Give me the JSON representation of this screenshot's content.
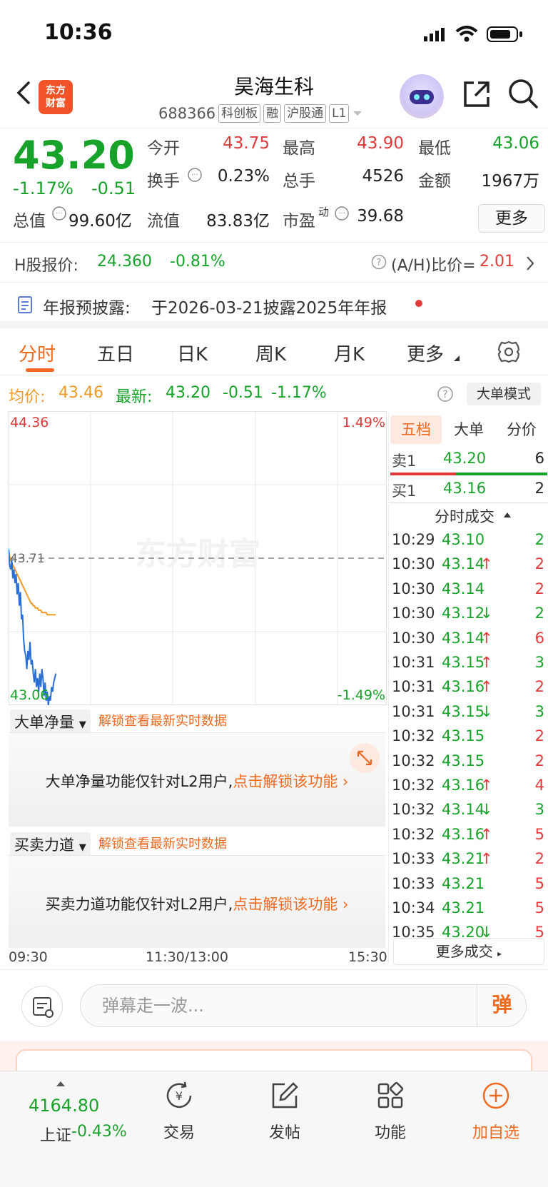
{
  "status_bar": {
    "time": "10:36"
  },
  "header": {
    "title": "昊海生科",
    "code": "688366",
    "tags": [
      "科创板",
      "融",
      "沪股通",
      "L1"
    ],
    "logo_text_line1": "东方",
    "logo_text_line2": "财富"
  },
  "quote": {
    "price": "43.20",
    "change_pct": "-1.17%",
    "change_abs": "-0.51",
    "open_label": "今开",
    "open": "43.75",
    "high_label": "最高",
    "high": "43.90",
    "low_label": "最低",
    "low": "43.06",
    "turnover_label": "换手",
    "turnover": "0.23%",
    "volume_label": "总手",
    "volume": "4526",
    "amount_label": "金额",
    "amount": "1967万",
    "mktcap_label": "总值",
    "mktcap": "99.60亿",
    "float_label": "流值",
    "float_cap": "83.83亿",
    "pe_label": "市盈",
    "pe_sup": "动",
    "pe": "39.68",
    "more_button": "更多"
  },
  "hshare": {
    "label": "H股报价:",
    "price": "24.360",
    "pct": "-0.81%",
    "ah_label": "(A/H)比价=",
    "ah_value": "2.01"
  },
  "annual": {
    "label": "年报预披露:",
    "text": "于2026-03-21披露2025年年报"
  },
  "tabs": [
    "分时",
    "五日",
    "日K",
    "周K",
    "月K",
    "更多"
  ],
  "avg_row": {
    "avg_label": "均价:",
    "avg": "43.46",
    "latest_label": "最新:",
    "latest": "43.20",
    "chg": "-0.51",
    "pct": "-1.17%",
    "mode_button": "大单模式"
  },
  "chart_data": {
    "type": "line",
    "title": "",
    "y_top": "44.36",
    "y_mid": "43.71",
    "y_bottom": "43.06",
    "pct_top": "1.49%",
    "pct_bottom": "-1.49%",
    "ylim": [
      43.06,
      44.36
    ],
    "prev_close": 43.71,
    "x_labels": [
      "09:30",
      "11:30/13:00",
      "15:30"
    ],
    "watermark": "东方财富",
    "series": [
      {
        "name": "价格",
        "color": "#2a6fd6",
        "values": [
          43.75,
          43.68,
          43.66,
          43.7,
          43.62,
          43.66,
          43.6,
          43.64,
          43.55,
          43.6,
          43.5,
          43.56,
          43.44,
          43.46,
          43.35,
          43.3,
          43.28,
          43.22,
          43.3,
          43.26,
          43.34,
          43.24,
          43.26,
          43.2,
          43.16,
          43.22,
          43.14,
          43.18,
          43.12,
          43.2,
          43.14,
          43.22,
          43.18,
          43.1,
          43.16,
          43.08,
          43.12,
          43.06,
          43.1,
          43.08,
          43.14,
          43.12,
          43.16,
          43.18,
          43.2
        ]
      },
      {
        "name": "均价",
        "color": "#f09a2a",
        "values": [
          43.75,
          43.72,
          43.7,
          43.69,
          43.68,
          43.67,
          43.66,
          43.65,
          43.64,
          43.63,
          43.62,
          43.61,
          43.6,
          43.59,
          43.58,
          43.57,
          43.56,
          43.55,
          43.54,
          43.53,
          43.52,
          43.51,
          43.51,
          43.5,
          43.5,
          43.49,
          43.49,
          43.49,
          43.48,
          43.48,
          43.48,
          43.47,
          43.47,
          43.47,
          43.47,
          43.47,
          43.46,
          43.46,
          43.46,
          43.46,
          43.46,
          43.46,
          43.46,
          43.46,
          43.46
        ]
      }
    ]
  },
  "l2": {
    "panel1_title": "大单净量",
    "panel2_title": "买卖力道",
    "unlock_link": "解锁查看最新实时数据",
    "msg1": "大单净量功能仅针对L2用户,",
    "msg2": "买卖力道功能仅针对L2用户,",
    "msg_link": "点击解锁该功能"
  },
  "right_panel": {
    "tabs": [
      "五档",
      "大单",
      "分价"
    ],
    "sell1": {
      "label": "卖1",
      "price": "43.20",
      "vol": "6"
    },
    "buy1": {
      "label": "买1",
      "price": "43.16",
      "vol": "2"
    },
    "ticks_title": "分时成交",
    "ticks": [
      {
        "t": "10:29",
        "p": "43.10",
        "a": "",
        "v": "2",
        "c": "green"
      },
      {
        "t": "10:30",
        "p": "43.14",
        "a": "↑",
        "v": "2",
        "c": "red"
      },
      {
        "t": "10:30",
        "p": "43.14",
        "a": "",
        "v": "2",
        "c": "red"
      },
      {
        "t": "10:30",
        "p": "43.12",
        "a": "↓",
        "v": "2",
        "c": "green"
      },
      {
        "t": "10:30",
        "p": "43.14",
        "a": "↑",
        "v": "6",
        "c": "red"
      },
      {
        "t": "10:31",
        "p": "43.15",
        "a": "↑",
        "v": "3",
        "c": "green"
      },
      {
        "t": "10:31",
        "p": "43.16",
        "a": "↑",
        "v": "2",
        "c": "red"
      },
      {
        "t": "10:31",
        "p": "43.15",
        "a": "↓",
        "v": "3",
        "c": "green"
      },
      {
        "t": "10:32",
        "p": "43.15",
        "a": "",
        "v": "2",
        "c": "red"
      },
      {
        "t": "10:32",
        "p": "43.15",
        "a": "",
        "v": "2",
        "c": "red"
      },
      {
        "t": "10:32",
        "p": "43.16",
        "a": "↑",
        "v": "4",
        "c": "red"
      },
      {
        "t": "10:32",
        "p": "43.14",
        "a": "↓",
        "v": "3",
        "c": "green"
      },
      {
        "t": "10:32",
        "p": "43.16",
        "a": "↑",
        "v": "5",
        "c": "red"
      },
      {
        "t": "10:33",
        "p": "43.21",
        "a": "↑",
        "v": "2",
        "c": "red"
      },
      {
        "t": "10:33",
        "p": "43.21",
        "a": "",
        "v": "5",
        "c": "red"
      },
      {
        "t": "10:34",
        "p": "43.21",
        "a": "",
        "v": "5",
        "c": "red"
      },
      {
        "t": "10:35",
        "p": "43.20",
        "a": "↓",
        "v": "5",
        "c": "red"
      }
    ],
    "more_ticks": "更多成交"
  },
  "barrage": {
    "placeholder": "弹幕走一波...",
    "button": "弹"
  },
  "nav": {
    "index_value": "4164.80",
    "index_name": "上证",
    "index_pct": "-0.43%",
    "items": [
      "交易",
      "发帖",
      "功能",
      "加自选"
    ]
  }
}
